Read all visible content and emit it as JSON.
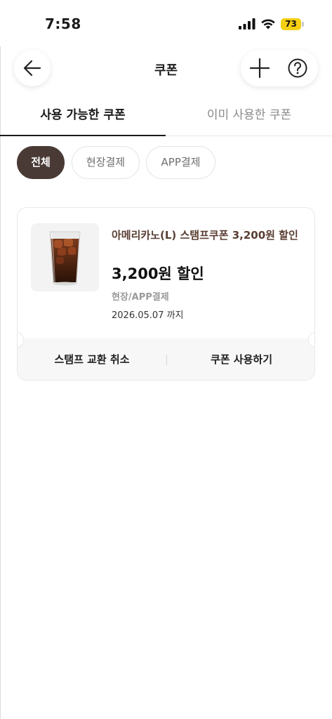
{
  "status_bar": {
    "time": "7:58",
    "battery_level": "73",
    "battery_color": "#f5cf11"
  },
  "header": {
    "title": "쿠폰",
    "back_icon": "arrow-left-icon",
    "add_icon": "plus-icon",
    "help_icon": "question-circle-icon"
  },
  "tabs": [
    {
      "label": "사용 가능한 쿠폰",
      "active": true
    },
    {
      "label": "이미 사용한 쿠폰",
      "active": false
    }
  ],
  "filters": [
    {
      "label": "전체",
      "selected": true
    },
    {
      "label": "현장결제",
      "selected": false
    },
    {
      "label": "APP결제",
      "selected": false
    }
  ],
  "coupon": {
    "name": "아메리카노(L) 스탬프쿠폰 3,200원 할인",
    "amount": "3,200원 할인",
    "payment_method": "현장/APP결제",
    "expiry": "2026.05.07 까지",
    "image_icon": "iced-americano-image",
    "cancel_label": "스탬프 교환 취소",
    "use_label": "쿠폰 사용하기"
  },
  "colors": {
    "accent": "#4a3a35",
    "coupon_name": "#5a3e33"
  }
}
